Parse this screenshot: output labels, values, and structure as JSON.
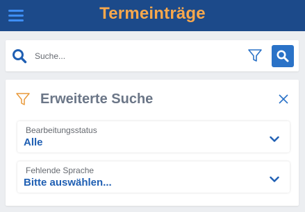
{
  "header": {
    "title": "Termeinträge",
    "menu_icon": "hamburger-menu-icon"
  },
  "search": {
    "placeholder": "Suche...",
    "search_icon": "magnifier-icon",
    "filter_icon": "funnel-icon",
    "button_icon": "magnifier-icon"
  },
  "advanced_search": {
    "title": "Erweiterte Suche",
    "title_icon": "funnel-icon",
    "close_icon": "close-icon",
    "fields": [
      {
        "label": "Bearbeitungsstatus",
        "value": "Alle"
      },
      {
        "label": "Fehlende Sprache",
        "value": "Bitte auswählen..."
      }
    ]
  },
  "colors": {
    "header_bg": "#1c4a8a",
    "title": "#f8a84c",
    "accent": "#2a72c7",
    "value_text": "#1f5fb3",
    "funnel_orange": "#e99a3b"
  }
}
